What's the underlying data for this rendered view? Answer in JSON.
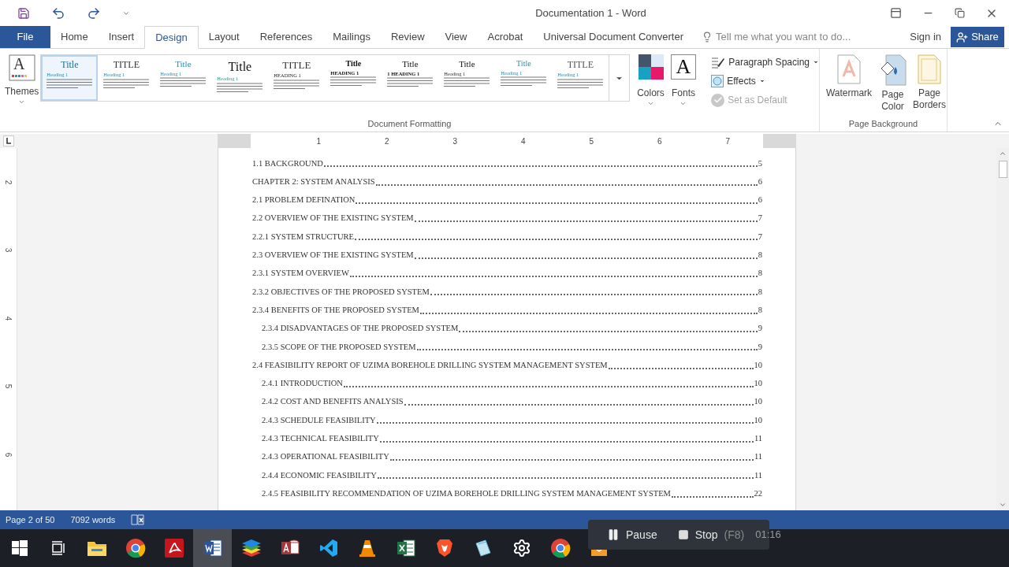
{
  "window": {
    "title": "Documentation 1 - Word"
  },
  "ribbon_tabs": [
    {
      "label": "File",
      "kind": "file",
      "selected": false
    },
    {
      "label": "Home",
      "kind": "tab",
      "selected": false
    },
    {
      "label": "Insert",
      "kind": "tab",
      "selected": false
    },
    {
      "label": "Design",
      "kind": "tab",
      "selected": true
    },
    {
      "label": "Layout",
      "kind": "tab",
      "selected": false
    },
    {
      "label": "References",
      "kind": "tab",
      "selected": false
    },
    {
      "label": "Mailings",
      "kind": "tab",
      "selected": false
    },
    {
      "label": "Review",
      "kind": "tab",
      "selected": false
    },
    {
      "label": "View",
      "kind": "tab",
      "selected": false
    },
    {
      "label": "Acrobat",
      "kind": "tab",
      "selected": false
    },
    {
      "label": "Universal Document Converter",
      "kind": "tab",
      "selected": false
    }
  ],
  "tell_me": {
    "placeholder": "Tell me what you want to do..."
  },
  "sign_in": "Sign in",
  "share": "Share",
  "document_formatting": {
    "label": "Document Formatting",
    "themes": "Themes",
    "themes_letter": "A",
    "fonts_letter": "A",
    "style_gallery": [
      {
        "title": "Title",
        "heading": "Heading 1",
        "selected": true
      },
      {
        "title": "TITLE",
        "heading": "Heading 1",
        "selected": false
      },
      {
        "title": "Title",
        "heading": "Heading 1",
        "selected": false
      },
      {
        "title": "Title",
        "heading": "Heading 1",
        "selected": false
      },
      {
        "title": "TITLE",
        "heading": "HEADING 1",
        "selected": false
      },
      {
        "title": "Title",
        "heading": "HEADING 1",
        "selected": false
      },
      {
        "title": "Title",
        "heading": "1 HEADING 1",
        "selected": false
      },
      {
        "title": "Title",
        "heading": "Heading 1",
        "selected": false
      },
      {
        "title": "Title",
        "heading": "Heading 1",
        "selected": false
      },
      {
        "title": "TITLE",
        "heading": "Heading 1",
        "selected": false
      }
    ],
    "colors": "Colors",
    "fonts": "Fonts",
    "options": [
      {
        "label": "Paragraph Spacing",
        "kind": "spacing",
        "dropdown": true,
        "disabled": false
      },
      {
        "label": "Effects",
        "kind": "effects",
        "dropdown": true,
        "disabled": false
      },
      {
        "label": "Set as Default",
        "kind": "default",
        "dropdown": false,
        "disabled": true
      }
    ]
  },
  "page_background": {
    "label": "Page Background",
    "buttons": [
      {
        "label": "Watermark",
        "kind": "watermark"
      },
      {
        "label": "Page Color",
        "kind": "color"
      },
      {
        "label": "Page Borders",
        "kind": "borders"
      }
    ]
  },
  "ruler": {
    "horizontal": [
      "1",
      "2",
      "3",
      "4",
      "5",
      "6",
      "7"
    ],
    "vertical": [
      "2",
      "3",
      "4",
      "5",
      "6"
    ]
  },
  "toc": [
    {
      "title": "1.1 BACKGROUND",
      "page": "5"
    },
    {
      "title": "CHAPTER 2: SYSTEM ANALYSIS",
      "page": "6"
    },
    {
      "title": "2.1 PROBLEM DEFINATION",
      "page": "6"
    },
    {
      "title": "2.2 OVERVIEW OF THE EXISTING SYSTEM",
      "page": "7"
    },
    {
      "title": "2.2.1 SYSTEM STRUCTURE",
      "page": "7"
    },
    {
      "title": "2.3 OVERVIEW OF THE EXISTING SYSTEM",
      "page": "8"
    },
    {
      "title": "2.3.1 SYSTEM OVERVIEW",
      "page": "8"
    },
    {
      "title": "2.3.2 OBJECTIVES OF THE PROPOSED SYSTEM",
      "page": "8"
    },
    {
      "title": "2.3.4 BENEFITS OF THE PROPOSED SYSTEM",
      "page": "8",
      "children": [
        {
          "title": "2.3.4 DISADVANTAGES OF THE PROPOSED SYSTEM",
          "page": "9"
        },
        {
          "title": "2.3.5 SCOPE OF THE PROPOSED SYSTEM",
          "page": "9"
        }
      ]
    },
    {
      "title": "2.4 FEASIBILITY REPORT OF UZIMA BOREHOLE DRILLING SYSTEM MANAGEMENT SYSTEM",
      "page": "10",
      "children": [
        {
          "title": "2.4.1 INTRODUCTION",
          "page": "10"
        },
        {
          "title": "2.4.2 COST AND BENEFITS ANALYSIS",
          "page": "10"
        },
        {
          "title": "2.4.3 SCHEDULE FEASIBILITY",
          "page": "10"
        },
        {
          "title": "2.4.3 TECHNICAL FEASIBILITY",
          "page": "11"
        },
        {
          "title": "2.4.3 OPERATIONAL FEASIBILITY",
          "page": "11"
        },
        {
          "title": "2.4.4 ECONOMIC FEASIBILITY",
          "page": "11"
        },
        {
          "title": "2.4.5 FEASIBILITY RECOMMENDATION OF UZIMA BOREHOLE DRILLING SYSTEM MANAGEMENT SYSTEM",
          "page": "22"
        }
      ]
    }
  ],
  "status_bar": {
    "page": "Page 2 of 50",
    "words": "7092 words"
  },
  "recorder": {
    "pause": "Pause",
    "stop": "Stop",
    "shortcut": "(F8)",
    "timer": "01:16"
  },
  "taskbar": [
    {
      "kind": "start",
      "selected": false
    },
    {
      "kind": "taskview",
      "selected": false
    },
    {
      "kind": "explorer",
      "selected": false
    },
    {
      "kind": "chrome",
      "selected": false
    },
    {
      "kind": "acrobat",
      "selected": false
    },
    {
      "kind": "word",
      "selected": true
    },
    {
      "kind": "bluestacks",
      "selected": false
    },
    {
      "kind": "access",
      "selected": false
    },
    {
      "kind": "vscode",
      "selected": false
    },
    {
      "kind": "vlc",
      "selected": false
    },
    {
      "kind": "excel",
      "selected": false
    },
    {
      "kind": "brave",
      "selected": false
    },
    {
      "kind": "notepad",
      "selected": false
    },
    {
      "kind": "settings",
      "selected": false
    },
    {
      "kind": "chrome",
      "selected": false
    },
    {
      "kind": "store",
      "selected": false
    }
  ]
}
